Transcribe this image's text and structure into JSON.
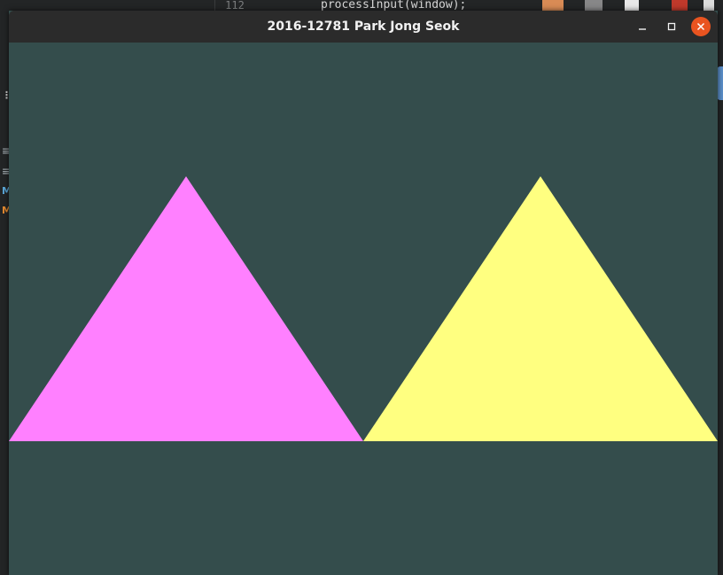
{
  "window": {
    "title": "2016-12781 Park Jong Seok",
    "controls": {
      "minimize_icon": "minimize-icon",
      "maximize_icon": "maximize-icon",
      "close_icon": "close-icon"
    }
  },
  "background_editor": {
    "line_number": "112",
    "code_line": "processInput(window);"
  },
  "scene": {
    "clear_color": "#344d4c",
    "triangles": [
      {
        "name": "left-triangle",
        "color": "#ff80ff"
      },
      {
        "name": "right-triangle",
        "color": "#ffff80"
      }
    ]
  },
  "colors": {
    "titlebar": "#2b2b2b",
    "close_button": "#e95420"
  }
}
